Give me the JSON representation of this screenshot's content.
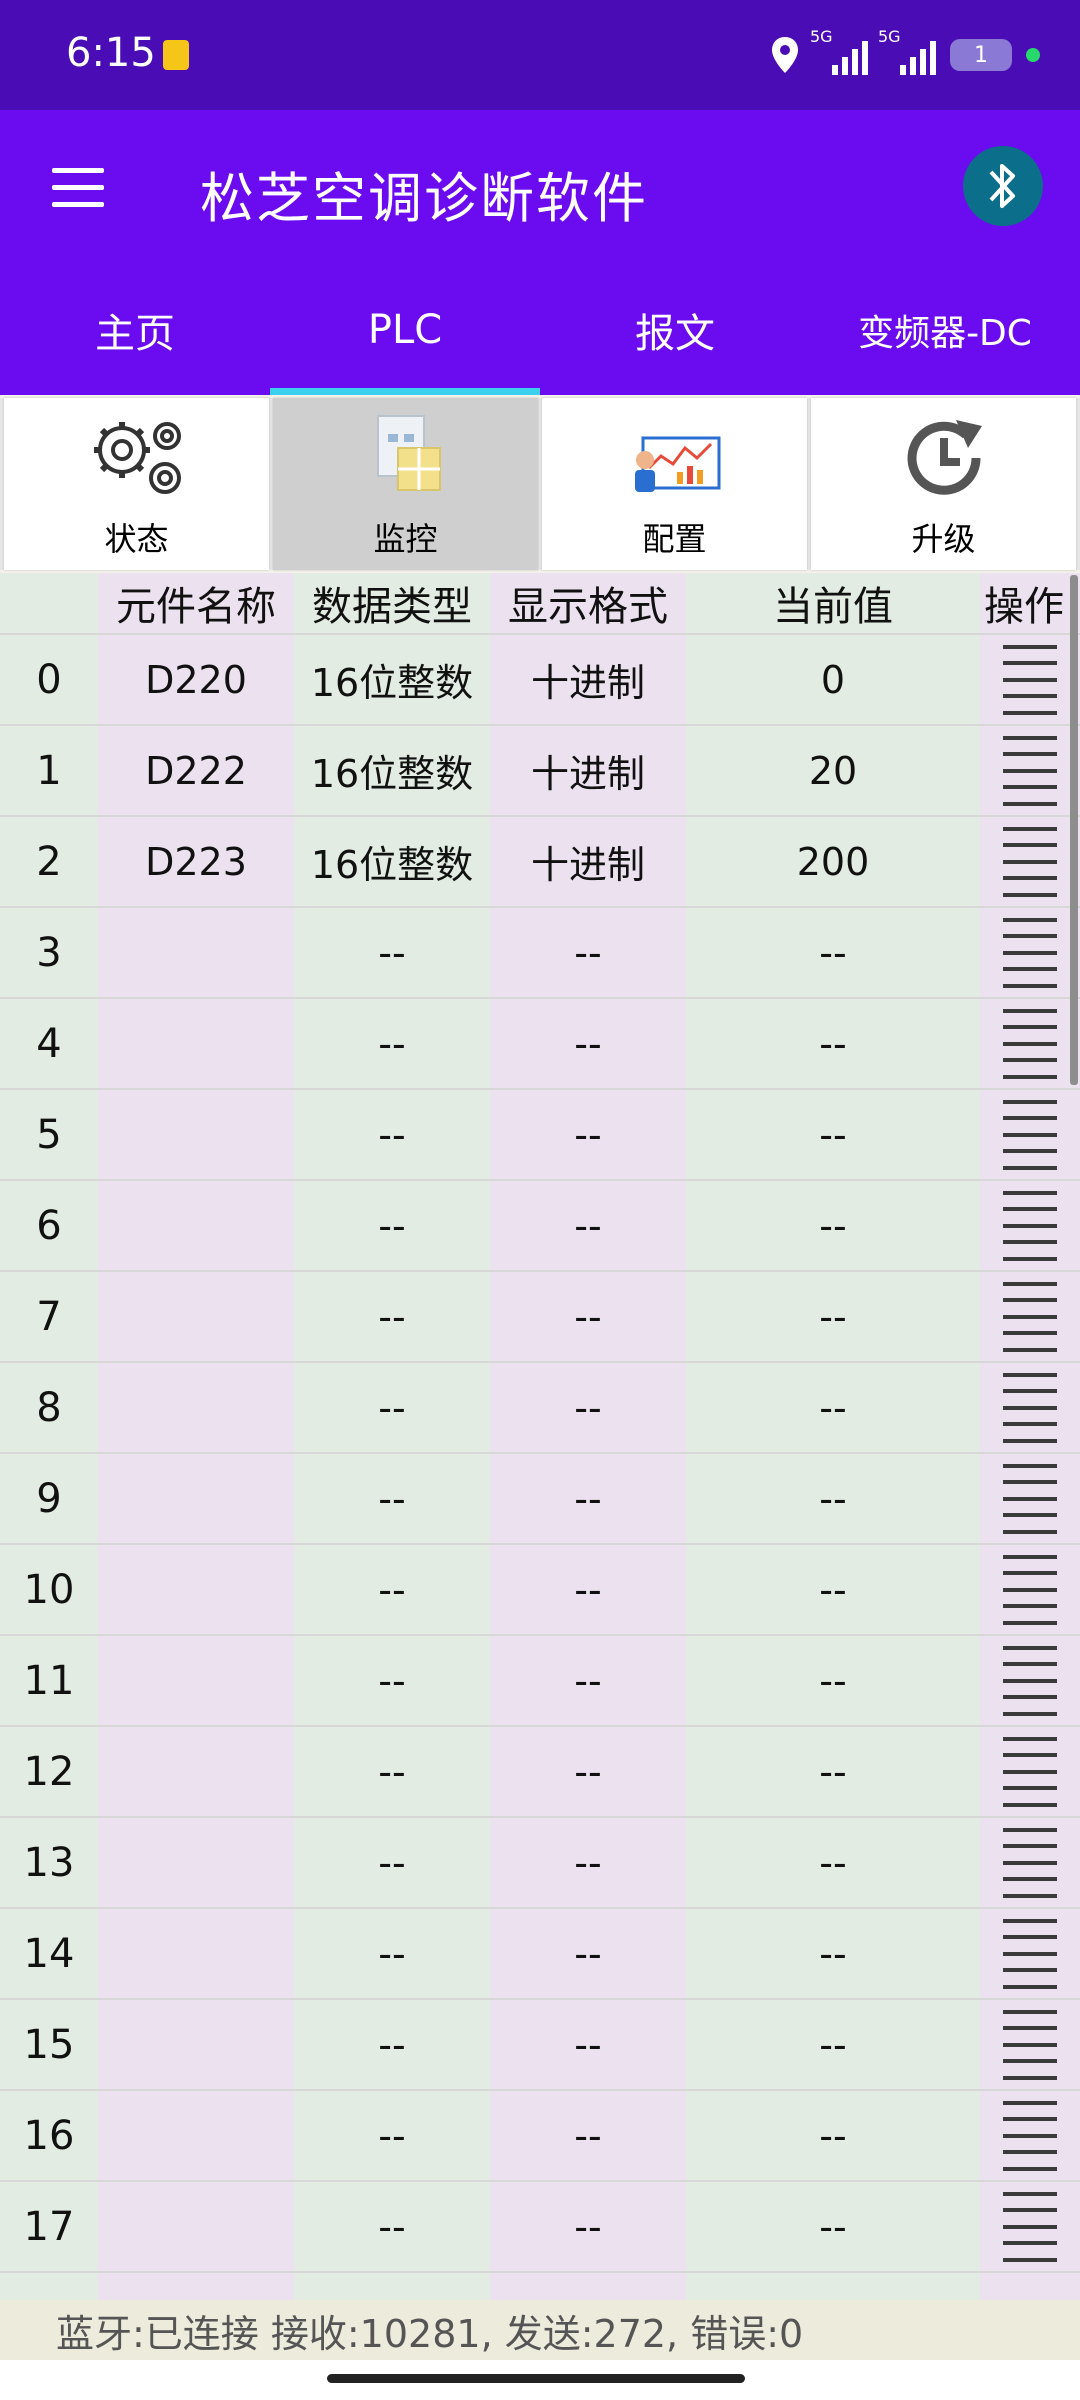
{
  "status_bar": {
    "time": "6:15",
    "signal1_label": "5G",
    "signal2_label": "5G",
    "battery": "1"
  },
  "app_bar": {
    "title": "松芝空调诊断软件",
    "menu_icon": "hamburger-menu-icon",
    "bluetooth_icon": "bluetooth-icon"
  },
  "tabs": [
    {
      "label": "主页",
      "active": false
    },
    {
      "label": "PLC",
      "active": true
    },
    {
      "label": "报文",
      "active": false
    },
    {
      "label": "变频器-DC",
      "active": false
    }
  ],
  "toolbar": [
    {
      "label": "状态",
      "icon": "gears-icon",
      "selected": false
    },
    {
      "label": "监控",
      "icon": "monitor-document-icon",
      "selected": true
    },
    {
      "label": "配置",
      "icon": "config-dashboard-icon",
      "selected": false
    },
    {
      "label": "升级",
      "icon": "upgrade-clock-icon",
      "selected": false
    }
  ],
  "table": {
    "headers": [
      "",
      "元件名称",
      "数据类型",
      "显示格式",
      "当前值",
      "操作"
    ],
    "rows": [
      {
        "index": "0",
        "name": "D220",
        "type": "16位整数",
        "format": "十进制",
        "value": "0"
      },
      {
        "index": "1",
        "name": "D222",
        "type": "16位整数",
        "format": "十进制",
        "value": "20"
      },
      {
        "index": "2",
        "name": "D223",
        "type": "16位整数",
        "format": "十进制",
        "value": "200"
      },
      {
        "index": "3",
        "name": "",
        "type": "--",
        "format": "--",
        "value": "--"
      },
      {
        "index": "4",
        "name": "",
        "type": "--",
        "format": "--",
        "value": "--"
      },
      {
        "index": "5",
        "name": "",
        "type": "--",
        "format": "--",
        "value": "--"
      },
      {
        "index": "6",
        "name": "",
        "type": "--",
        "format": "--",
        "value": "--"
      },
      {
        "index": "7",
        "name": "",
        "type": "--",
        "format": "--",
        "value": "--"
      },
      {
        "index": "8",
        "name": "",
        "type": "--",
        "format": "--",
        "value": "--"
      },
      {
        "index": "9",
        "name": "",
        "type": "--",
        "format": "--",
        "value": "--"
      },
      {
        "index": "10",
        "name": "",
        "type": "--",
        "format": "--",
        "value": "--"
      },
      {
        "index": "11",
        "name": "",
        "type": "--",
        "format": "--",
        "value": "--"
      },
      {
        "index": "12",
        "name": "",
        "type": "--",
        "format": "--",
        "value": "--"
      },
      {
        "index": "13",
        "name": "",
        "type": "--",
        "format": "--",
        "value": "--"
      },
      {
        "index": "14",
        "name": "",
        "type": "--",
        "format": "--",
        "value": "--"
      },
      {
        "index": "15",
        "name": "",
        "type": "--",
        "format": "--",
        "value": "--"
      },
      {
        "index": "16",
        "name": "",
        "type": "--",
        "format": "--",
        "value": "--"
      },
      {
        "index": "17",
        "name": "",
        "type": "--",
        "format": "--",
        "value": "--"
      }
    ],
    "ops_icon": "row-menu-icon",
    "column_colors": [
      "#e2ece2",
      "#ece2ef",
      "#e2ece2",
      "#ece2ef",
      "#e2ece2",
      "#ece2ef"
    ]
  },
  "footer": {
    "status": "蓝牙:已连接 接收:10281, 发送:272, 错误:0"
  }
}
